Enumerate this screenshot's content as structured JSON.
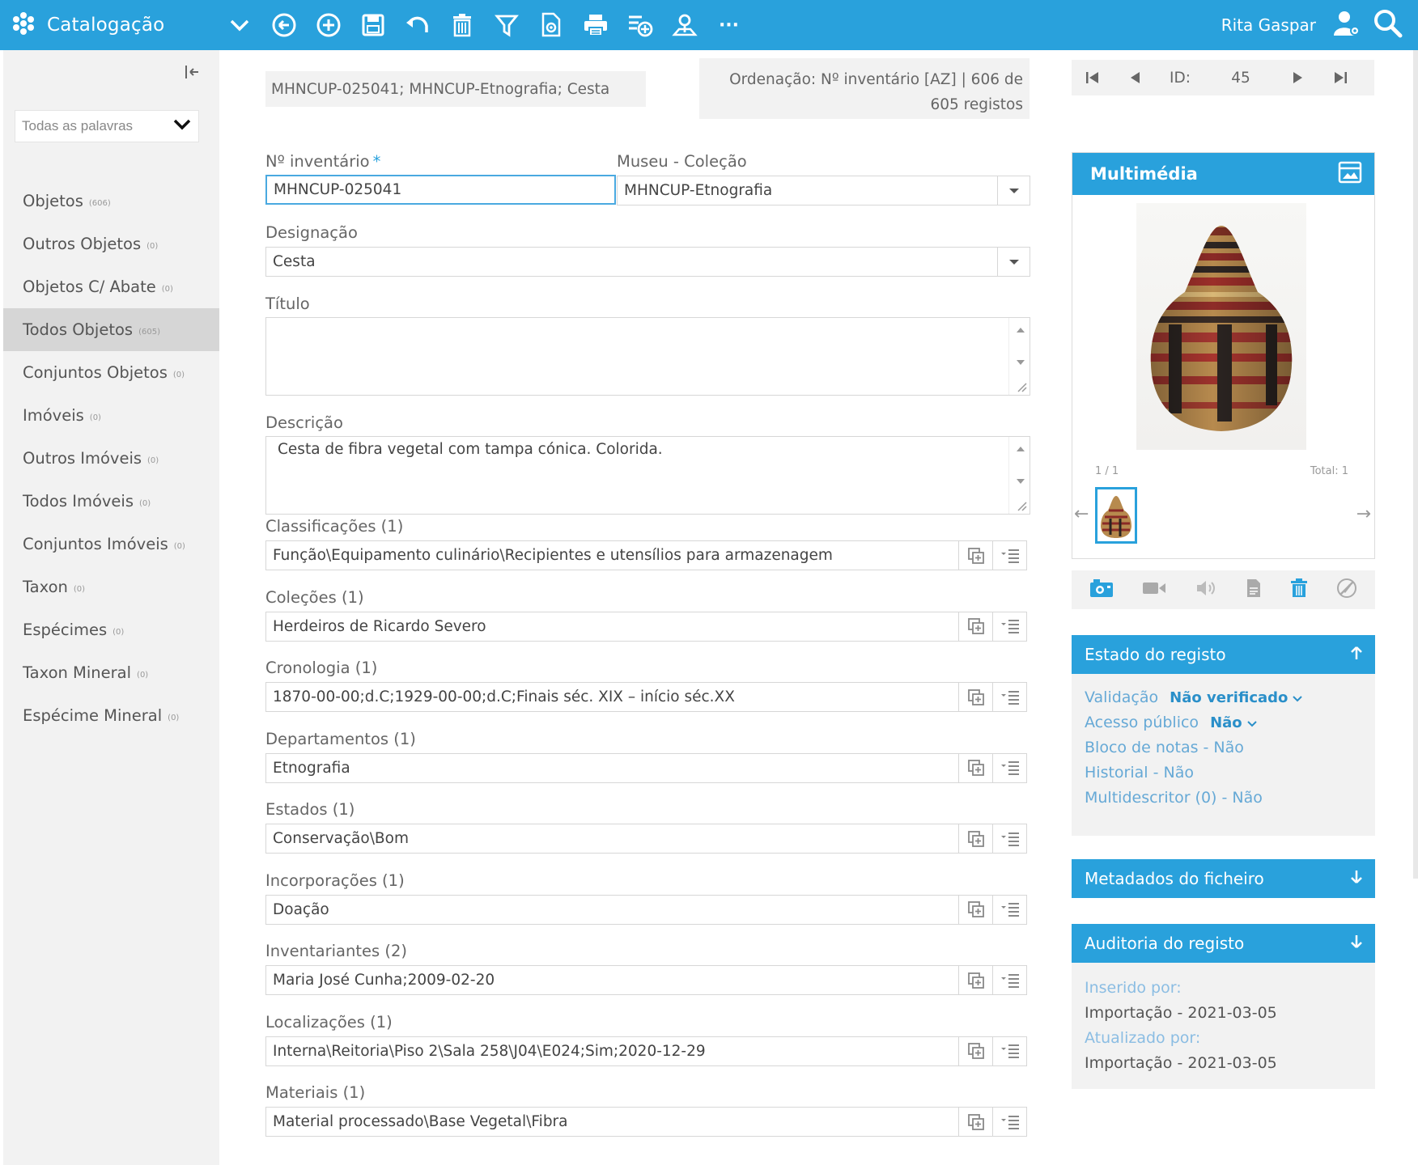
{
  "app": {
    "title": "Catalogação",
    "user": "Rita Gaspar"
  },
  "toolbar": {
    "icons": [
      "chevron-down-icon",
      "back-icon",
      "add-icon",
      "save-icon",
      "undo-icon",
      "delete-icon",
      "filter-icon",
      "preview-icon",
      "print-icon",
      "new-list-icon",
      "map-icon",
      "more-icon"
    ],
    "more_label": "···"
  },
  "sidebar": {
    "search_mode": "Todas as palavras",
    "items": [
      {
        "label": "Objetos",
        "count": "(606)"
      },
      {
        "label": "Outros Objetos",
        "count": "(0)"
      },
      {
        "label": "Objetos C/ Abate",
        "count": "(0)"
      },
      {
        "label": "Todos Objetos",
        "count": "(605)",
        "active": true
      },
      {
        "label": "Conjuntos Objetos",
        "count": "(0)"
      },
      {
        "label": "Imóveis",
        "count": "(0)"
      },
      {
        "label": "Outros Imóveis",
        "count": "(0)"
      },
      {
        "label": "Todos Imóveis",
        "count": "(0)"
      },
      {
        "label": "Conjuntos Imóveis",
        "count": "(0)"
      },
      {
        "label": "Taxon",
        "count": "(0)"
      },
      {
        "label": "Espécimes",
        "count": "(0)"
      },
      {
        "label": "Taxon Mineral",
        "count": "(0)"
      },
      {
        "label": "Espécime Mineral",
        "count": "(0)"
      }
    ]
  },
  "header": {
    "summary": "MHNCUP-025041; MHNCUP-Etnografia; Cesta",
    "ordering_line1": "Ordenação: Nº inventário [AZ] | 606 de",
    "ordering_line2": "605 registos"
  },
  "form": {
    "inventory": {
      "label": "Nº inventário",
      "required_mark": "*",
      "value": "MHNCUP-025041"
    },
    "museum": {
      "label": "Museu - Coleção",
      "value": "MHNCUP-Etnografia"
    },
    "designation": {
      "label": "Designação",
      "value": "Cesta"
    },
    "title": {
      "label": "Título",
      "value": ""
    },
    "description": {
      "label": "Descrição",
      "value": "Cesta de fibra vegetal com tampa cónica. Colorida."
    },
    "multi": [
      {
        "label": "Classificações (1)",
        "value": "Função\\Equipamento culinário\\Recipientes e utensílios para armazenagem"
      },
      {
        "label": "Coleções (1)",
        "value": "Herdeiros de Ricardo Severo"
      },
      {
        "label": "Cronologia (1)",
        "value": "1870-00-00;d.C;1929-00-00;d.C;Finais séc. XIX – início séc.XX"
      },
      {
        "label": "Departamentos (1)",
        "value": "Etnografia"
      },
      {
        "label": "Estados (1)",
        "value": "Conservação\\Bom"
      },
      {
        "label": "Incorporações (1)",
        "value": "Doação"
      },
      {
        "label": "Inventariantes (2)",
        "value": "Maria José Cunha;2009-02-20"
      },
      {
        "label": "Localizações (1)",
        "value": "Interna\\Reitoria\\Piso 2\\Sala 258\\J04\\E024;Sim;2020-12-29"
      },
      {
        "label": "Materiais (1)",
        "value": "Material processado\\Base Vegetal\\Fibra"
      }
    ]
  },
  "record_nav": {
    "id_label": "ID:",
    "id_value": "45"
  },
  "multimedia": {
    "title": "Multimédia",
    "counter": "1 / 1",
    "total": "Total: 1",
    "media_icons": [
      "camera-icon",
      "video-icon",
      "audio-icon",
      "document-icon",
      "delete-icon",
      "no-edit-icon"
    ]
  },
  "record_state": {
    "title": "Estado do registo",
    "validation_label": "Validação",
    "validation_value": "Não verificado",
    "public_label": "Acesso público",
    "public_value": "Não",
    "notes": "Bloco de notas - Não",
    "history": "Historial - Não",
    "multidescriptor": "Multidescritor (0) - Não"
  },
  "file_metadata": {
    "title": "Metadados do ficheiro"
  },
  "audit": {
    "title": "Auditoria do registo",
    "inserted_label": "Inserido por:",
    "inserted_value": "Importação - 2021-03-05",
    "updated_label": "Atualizado por:",
    "updated_value": "Importação - 2021-03-05"
  },
  "colors": {
    "accent": "#29a1dc",
    "sidebar_bg": "#f2f2f2",
    "active_bg": "#d6d6d6",
    "link": "#66a9d6"
  }
}
